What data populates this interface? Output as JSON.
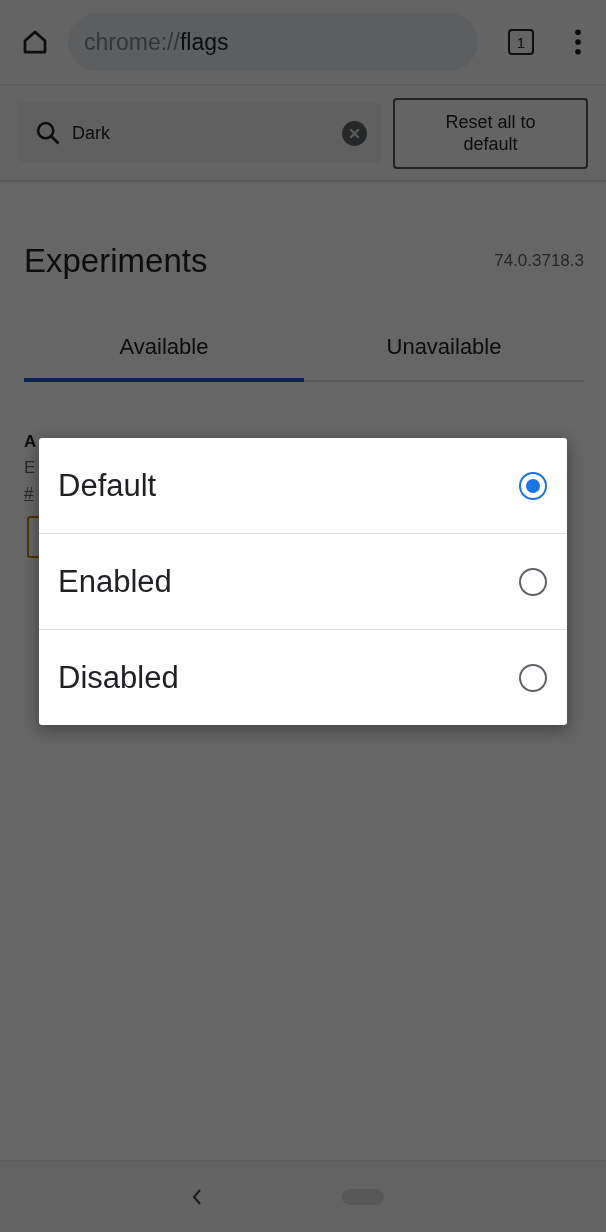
{
  "toolbar": {
    "url": "chrome://**flags**",
    "tab_count": "1"
  },
  "search": {
    "value": "Dark",
    "reset_button": "Reset all to default"
  },
  "header": {
    "title": "Experiments",
    "version": "74.0.3718.3"
  },
  "tabs": [
    {
      "label": "Available",
      "selected": true
    },
    {
      "label": "Unavailable",
      "selected": false
    }
  ],
  "flag": {
    "title": "A",
    "description": "E",
    "link": "#"
  },
  "dialog": {
    "options": [
      {
        "label": "Default",
        "selected": true
      },
      {
        "label": "Enabled",
        "selected": false
      },
      {
        "label": "Disabled",
        "selected": false
      }
    ]
  }
}
